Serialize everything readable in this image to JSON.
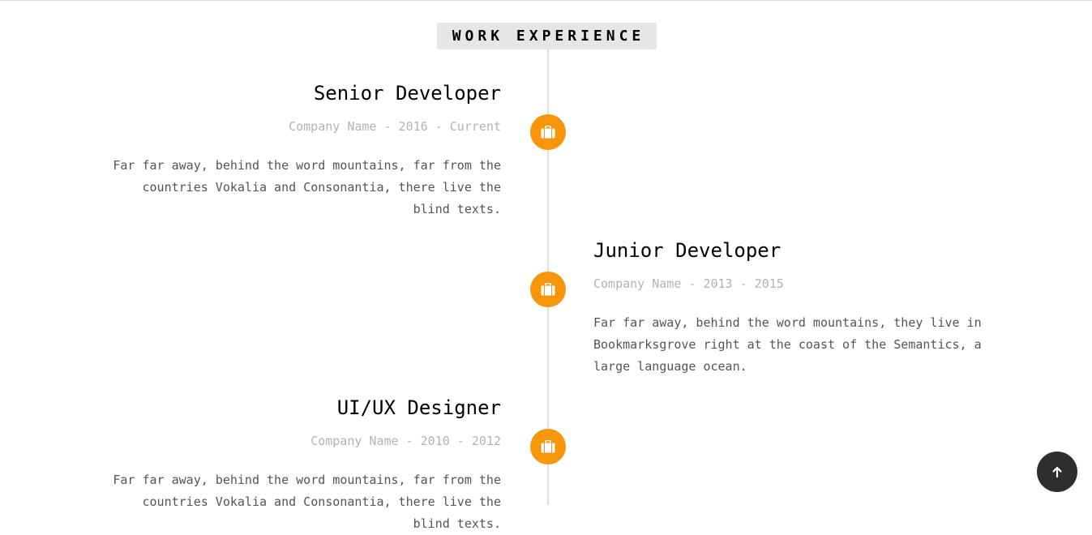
{
  "section": {
    "heading": "WORK EXPERIENCE"
  },
  "timeline": [
    {
      "title": "Senior Developer",
      "meta": "Company Name - 2016 - Current",
      "description": "Far far away, behind the word mountains, far from the countries Vokalia and Consonantia, there live the blind texts.",
      "icon": "briefcase-icon"
    },
    {
      "title": "Junior Developer",
      "meta": "Company Name - 2013 - 2015",
      "description": "Far far away, behind the word mountains, they live in Bookmarksgrove right at the coast of the Semantics, a large language ocean.",
      "icon": "briefcase-icon"
    },
    {
      "title": "UI/UX Designer",
      "meta": "Company Name - 2010 - 2012",
      "description": "Far far away, behind the word mountains, far from the countries Vokalia and Consonantia, there live the blind texts.",
      "icon": "briefcase-icon"
    }
  ],
  "back_to_top": {
    "icon": "arrow-up-icon"
  },
  "colors": {
    "accent": "#f7960a",
    "heading_bg": "#e6e6e6",
    "meta_text": "#b3b3b3",
    "body_text": "#555555",
    "back_to_top_bg": "#2e2e2e"
  }
}
